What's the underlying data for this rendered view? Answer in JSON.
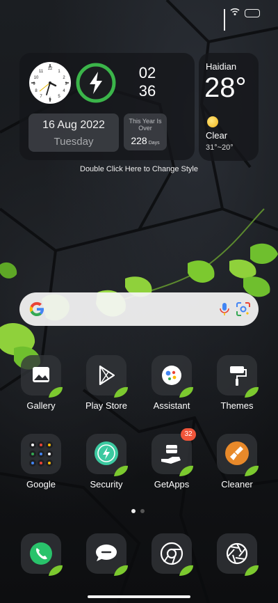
{
  "clock_widget": {
    "hour": "02",
    "minute": "36",
    "date": "16 Aug 2022",
    "weekday": "Tuesday",
    "year_label": "This Year Is Over",
    "year_days": "228",
    "year_unit": "Days"
  },
  "weather": {
    "city": "Haidian",
    "temperature": "28°",
    "condition": "Clear",
    "range": "31°~20°",
    "icon": "sun-icon"
  },
  "hint": "Double Click Here to Change Style",
  "search": {
    "icon": "google-logo-icon"
  },
  "apps_row1": [
    {
      "label": "Gallery",
      "icon": "gallery-icon"
    },
    {
      "label": "Play Store",
      "icon": "play-store-icon"
    },
    {
      "label": "Assistant",
      "icon": "assistant-icon"
    },
    {
      "label": "Themes",
      "icon": "themes-icon"
    }
  ],
  "apps_row2": [
    {
      "label": "Google",
      "icon": "google-folder-icon"
    },
    {
      "label": "Security",
      "icon": "security-icon"
    },
    {
      "label": "GetApps",
      "icon": "getapps-icon",
      "badge": "32"
    },
    {
      "label": "Cleaner",
      "icon": "cleaner-icon"
    }
  ],
  "dock": [
    {
      "icon": "phone-icon"
    },
    {
      "icon": "messaging-icon"
    },
    {
      "icon": "chrome-icon"
    },
    {
      "icon": "camera-icon"
    }
  ],
  "colors": {
    "accent_green": "#3bb54a",
    "badge": "#f0553a"
  }
}
